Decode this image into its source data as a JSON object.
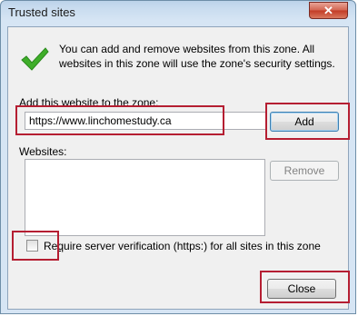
{
  "window": {
    "title": "Trusted sites",
    "close_glyph": "✕"
  },
  "info": {
    "icon": "checkmark-icon",
    "text": "You can add and remove websites from this zone. All websites in this zone will use the zone's security settings."
  },
  "add_site": {
    "label": "Add this website to the zone:",
    "value": "https://www.linchomestudy.ca",
    "button_label": "Add"
  },
  "websites": {
    "label": "Websites:",
    "items": [],
    "remove_label": "Remove"
  },
  "verification": {
    "checked": false,
    "label_pre": "Re",
    "label_accel": "q",
    "label_post": "uire server verification (https:) for all sites in this zone"
  },
  "footer": {
    "close_label": "Close"
  },
  "colors": {
    "highlight": "#b51e32",
    "check_green": "#3fae2a"
  }
}
